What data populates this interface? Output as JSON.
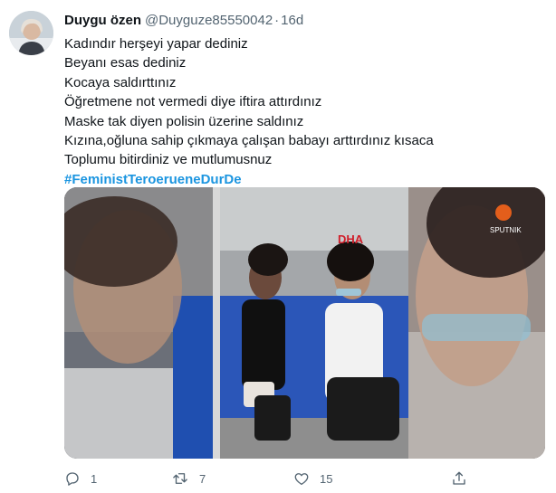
{
  "tweet": {
    "name": "Duygu özen",
    "handle": "@Duyguze85550042",
    "separator": "·",
    "time": "16d",
    "lines": [
      "Kadındır herşeyi yapar dediniz",
      "Beyanı esas dediniz",
      "Kocaya saldırttınız",
      "Öğretmene not vermedi diye iftira attırdınız",
      "Maske tak diyen polisin üzerine saldınız",
      "Kızına,oğluna sahip çıkmaya çalışan babayı arttırdınız kısaca",
      "Toplumu bitirdiniz  ve  mutlumusnuz"
    ],
    "hashtag": "#FeministTeroerueneDurDe"
  },
  "media": {
    "watermark_dha": "DHA",
    "watermark_sputnik": "SPUTNIK"
  },
  "actions": {
    "reply_count": "1",
    "retweet_count": "7",
    "like_count": "15"
  },
  "colors": {
    "hashtag": "#1b95e0",
    "secondary_text": "#536471",
    "seat_blue": "#2b56b8"
  }
}
